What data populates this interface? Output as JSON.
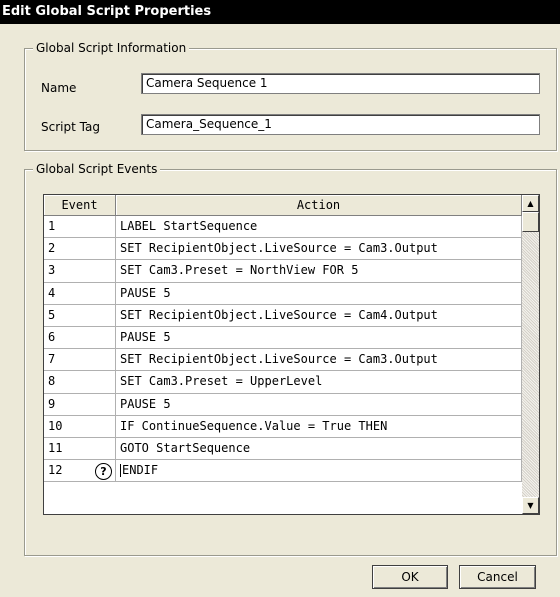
{
  "window": {
    "title": "Edit Global Script Properties"
  },
  "info": {
    "legend": "Global Script Information",
    "name_label": "Name",
    "name_value": "Camera Sequence 1",
    "tag_label": "Script Tag",
    "tag_value": "Camera_Sequence_1"
  },
  "events": {
    "legend": "Global Script Events",
    "columns": {
      "event": "Event",
      "action": "Action"
    },
    "rows": [
      {
        "event": "1",
        "action": "LABEL StartSequence"
      },
      {
        "event": "2",
        "action": "SET RecipientObject.LiveSource = Cam3.Output"
      },
      {
        "event": "3",
        "action": "SET Cam3.Preset = NorthView FOR 5"
      },
      {
        "event": "4",
        "action": "PAUSE 5"
      },
      {
        "event": "5",
        "action": "SET RecipientObject.LiveSource = Cam4.Output"
      },
      {
        "event": "6",
        "action": "PAUSE 5"
      },
      {
        "event": "7",
        "action": "SET RecipientObject.LiveSource = Cam3.Output"
      },
      {
        "event": "8",
        "action": "SET Cam3.Preset = UpperLevel"
      },
      {
        "event": "9",
        "action": "PAUSE 5"
      },
      {
        "event": "10",
        "action": "IF ContinueSequence.Value = True THEN"
      },
      {
        "event": "11",
        "action": "GOTO StartSequence"
      },
      {
        "event": "12",
        "action": "ENDIF"
      }
    ],
    "help_icon": "question-mark-circle-icon",
    "scroll_up_icon": "arrow-up-icon",
    "scroll_down_icon": "arrow-down-icon"
  },
  "buttons": {
    "ok": "OK",
    "cancel": "Cancel"
  }
}
